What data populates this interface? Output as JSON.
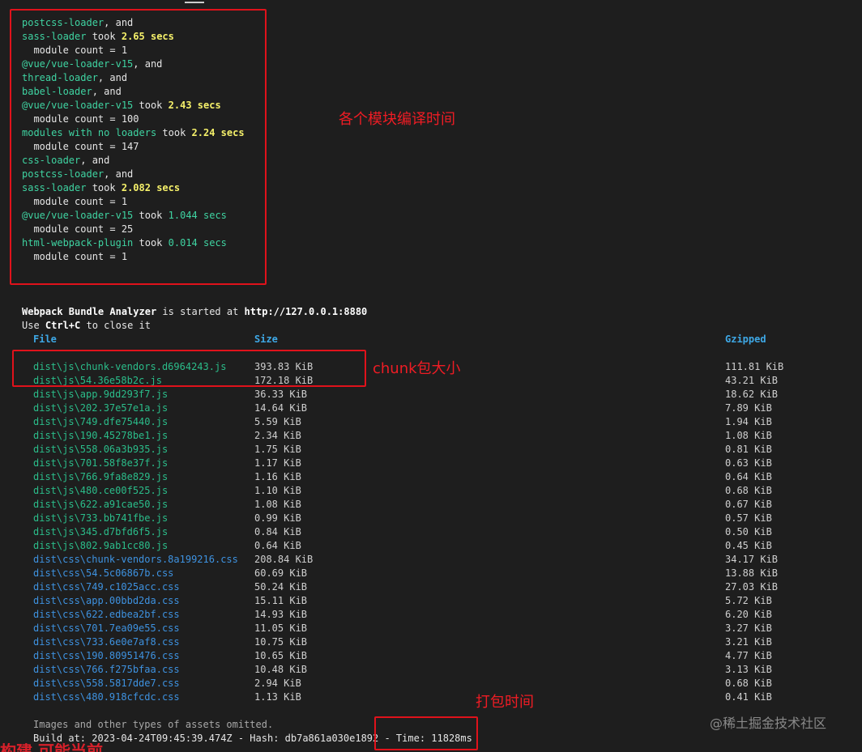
{
  "log": [
    [
      {
        "t": "postcss-loader",
        "c": "g"
      },
      {
        "t": ", and",
        "c": "w"
      }
    ],
    [
      {
        "t": "sass-loader",
        "c": "g"
      },
      {
        "t": " took ",
        "c": "w"
      },
      {
        "t": "2.65 secs",
        "c": "y"
      }
    ],
    [
      {
        "t": "  module count = 1",
        "c": "w"
      }
    ],
    [
      {
        "t": "@vue/vue-loader-v15",
        "c": "g"
      },
      {
        "t": ", and",
        "c": "w"
      }
    ],
    [
      {
        "t": "thread-loader",
        "c": "g"
      },
      {
        "t": ", and",
        "c": "w"
      }
    ],
    [
      {
        "t": "babel-loader",
        "c": "g"
      },
      {
        "t": ", and",
        "c": "w"
      }
    ],
    [
      {
        "t": "@vue/vue-loader-v15",
        "c": "g"
      },
      {
        "t": " took ",
        "c": "w"
      },
      {
        "t": "2.43 secs",
        "c": "y"
      }
    ],
    [
      {
        "t": "  module count = 100",
        "c": "w"
      }
    ],
    [
      {
        "t": "modules with no loaders",
        "c": "g"
      },
      {
        "t": " took ",
        "c": "w"
      },
      {
        "t": "2.24 secs",
        "c": "y"
      }
    ],
    [
      {
        "t": "  module count = 147",
        "c": "w"
      }
    ],
    [
      {
        "t": "css-loader",
        "c": "g"
      },
      {
        "t": ", and",
        "c": "w"
      }
    ],
    [
      {
        "t": "postcss-loader",
        "c": "g"
      },
      {
        "t": ", and",
        "c": "w"
      }
    ],
    [
      {
        "t": "sass-loader",
        "c": "g"
      },
      {
        "t": " took ",
        "c": "w"
      },
      {
        "t": "2.082 secs",
        "c": "y"
      }
    ],
    [
      {
        "t": "  module count = 1",
        "c": "w"
      }
    ],
    [
      {
        "t": "@vue/vue-loader-v15",
        "c": "g"
      },
      {
        "t": " took ",
        "c": "w"
      },
      {
        "t": "1.044 secs",
        "c": "g"
      }
    ],
    [
      {
        "t": "  module count = 25",
        "c": "w"
      }
    ],
    [
      {
        "t": "html-webpack-plugin",
        "c": "g"
      },
      {
        "t": " took ",
        "c": "w"
      },
      {
        "t": "0.014 secs",
        "c": "g"
      }
    ],
    [
      {
        "t": "  module count = 1",
        "c": "w"
      }
    ]
  ],
  "analyzer": {
    "prefix": "Webpack Bundle Analyzer",
    "middle": " is started at ",
    "url": "http://127.0.0.1:8880",
    "close_pre": "Use ",
    "close_key": "Ctrl+C",
    "close_post": " to close it"
  },
  "table": {
    "headers": [
      "File",
      "Size",
      "Gzipped"
    ],
    "rows": [
      {
        "file": "dist\\js\\chunk-vendors.d6964243.js",
        "size": "393.83 KiB",
        "gzip": "111.81 KiB",
        "type": "js"
      },
      {
        "file": "dist\\js\\54.36e58b2c.js",
        "size": "172.18 KiB",
        "gzip": "43.21 KiB",
        "type": "js"
      },
      {
        "file": "dist\\js\\app.9dd293f7.js",
        "size": "36.33 KiB",
        "gzip": "18.62 KiB",
        "type": "js"
      },
      {
        "file": "dist\\js\\202.37e57e1a.js",
        "size": "14.64 KiB",
        "gzip": "7.89 KiB",
        "type": "js"
      },
      {
        "file": "dist\\js\\749.dfe75440.js",
        "size": "5.59 KiB",
        "gzip": "1.94 KiB",
        "type": "js"
      },
      {
        "file": "dist\\js\\190.45278be1.js",
        "size": "2.34 KiB",
        "gzip": "1.08 KiB",
        "type": "js"
      },
      {
        "file": "dist\\js\\558.06a3b935.js",
        "size": "1.75 KiB",
        "gzip": "0.81 KiB",
        "type": "js"
      },
      {
        "file": "dist\\js\\701.58f8e37f.js",
        "size": "1.17 KiB",
        "gzip": "0.63 KiB",
        "type": "js"
      },
      {
        "file": "dist\\js\\766.9fa8e829.js",
        "size": "1.16 KiB",
        "gzip": "0.64 KiB",
        "type": "js"
      },
      {
        "file": "dist\\js\\480.ce00f525.js",
        "size": "1.10 KiB",
        "gzip": "0.68 KiB",
        "type": "js"
      },
      {
        "file": "dist\\js\\622.a91cae50.js",
        "size": "1.08 KiB",
        "gzip": "0.67 KiB",
        "type": "js"
      },
      {
        "file": "dist\\js\\733.bb741fbe.js",
        "size": "0.99 KiB",
        "gzip": "0.57 KiB",
        "type": "js"
      },
      {
        "file": "dist\\js\\345.d7bfd6f5.js",
        "size": "0.84 KiB",
        "gzip": "0.50 KiB",
        "type": "js"
      },
      {
        "file": "dist\\js\\802.9ab1cc80.js",
        "size": "0.64 KiB",
        "gzip": "0.45 KiB",
        "type": "js"
      },
      {
        "file": "dist\\css\\chunk-vendors.8a199216.css",
        "size": "208.84 KiB",
        "gzip": "34.17 KiB",
        "type": "css"
      },
      {
        "file": "dist\\css\\54.5c06867b.css",
        "size": "60.69 KiB",
        "gzip": "13.88 KiB",
        "type": "css"
      },
      {
        "file": "dist\\css\\749.c1025acc.css",
        "size": "50.24 KiB",
        "gzip": "27.03 KiB",
        "type": "css"
      },
      {
        "file": "dist\\css\\app.00bbd2da.css",
        "size": "15.11 KiB",
        "gzip": "5.72 KiB",
        "type": "css"
      },
      {
        "file": "dist\\css\\622.edbea2bf.css",
        "size": "14.93 KiB",
        "gzip": "6.20 KiB",
        "type": "css"
      },
      {
        "file": "dist\\css\\701.7ea09e55.css",
        "size": "11.05 KiB",
        "gzip": "3.27 KiB",
        "type": "css"
      },
      {
        "file": "dist\\css\\733.6e0e7af8.css",
        "size": "10.75 KiB",
        "gzip": "3.21 KiB",
        "type": "css"
      },
      {
        "file": "dist\\css\\190.80951476.css",
        "size": "10.65 KiB",
        "gzip": "4.77 KiB",
        "type": "css"
      },
      {
        "file": "dist\\css\\766.f275bfaa.css",
        "size": "10.48 KiB",
        "gzip": "3.13 KiB",
        "type": "css"
      },
      {
        "file": "dist\\css\\558.5817dde7.css",
        "size": "2.94 KiB",
        "gzip": "0.68 KiB",
        "type": "css"
      },
      {
        "file": "dist\\css\\480.918cfcdc.css",
        "size": "1.13 KiB",
        "gzip": "0.41 KiB",
        "type": "css"
      }
    ]
  },
  "footer": {
    "omitted": "Images and other types of assets omitted.",
    "build": "Build at: 2023-04-24T09:45:39.474Z - Hash: db7a861a030e1892 - Time: 11828ms"
  },
  "annotations": {
    "module_time": "各个模块编译时间",
    "chunk_size": "chunk包大小",
    "pack_time": "打包时间",
    "bottom_cut": "构建 可能当前"
  },
  "watermark": "@稀土掘金技术社区",
  "colors": {
    "loader_green": "#3fd4a2",
    "time_yellow": "#f5f06a",
    "header_blue": "#3ea8e6",
    "js_green": "#2bbd8a",
    "css_blue": "#3e92e0",
    "annotation_red": "#e0121b"
  }
}
